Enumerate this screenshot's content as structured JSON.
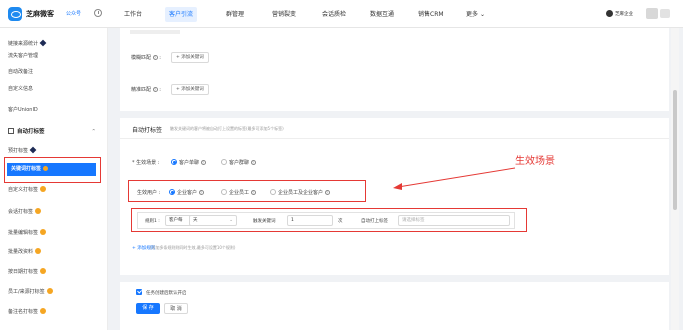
{
  "app": {
    "name": "芝麻微客",
    "account_tag": "公众号"
  },
  "nav": {
    "items": [
      "工作台",
      "客户引流",
      "群管理",
      "营销裂变",
      "会话质检",
      "数据互通",
      "销售CRM",
      "更多"
    ],
    "active_index": 1
  },
  "user": {
    "name": "芝麻企业"
  },
  "sidebar": {
    "items_above": [
      "链接来源统计",
      "流失客户管理",
      "自动改备注",
      "自定义信息",
      "客户UnionID"
    ],
    "group": {
      "label": "自动打标签"
    },
    "items_below": [
      {
        "label": "预打标签",
        "badge": "diamond"
      },
      {
        "label": "关键词打标签",
        "badge": "coin"
      },
      {
        "label": "自定义打标签",
        "badge": "coin"
      },
      {
        "label": "会话打标签",
        "badge": "coin"
      },
      {
        "label": "批量编辑标签",
        "badge": "coin"
      },
      {
        "label": "批量改资料",
        "badge": "coin"
      },
      {
        "label": "按日期打标签",
        "badge": "coin"
      },
      {
        "label": "员工/来源打标签",
        "badge": "coin"
      },
      {
        "label": "备注名打标签",
        "badge": "coin"
      }
    ],
    "active_label": "关键词打标签"
  },
  "keyword_card": {
    "fuzzy_label": "模糊匹配",
    "exact_label": "精准匹配",
    "add_keyword_label": "+ 添加关键词"
  },
  "tag_card": {
    "title": "自动打标签",
    "hint": "触发关键词的客户将被自动打上设置的标签(最多可添加5个标签)",
    "scene": {
      "label": "* 生效场景 :",
      "options": [
        "客户单聊",
        "客户群聊"
      ],
      "selected": 0
    },
    "target": {
      "label": "生效用户 :",
      "options": [
        "企业客户",
        "企业员工",
        "企业员工及企业客户"
      ],
      "selected": 0
    },
    "rule": {
      "label": "规则1 :",
      "subject": "客户每",
      "period": "天",
      "trigger_label": "触发关键词",
      "count": "1",
      "unit": "次",
      "tag_label": "自动打上标签",
      "tag_placeholder": "请选择标签"
    },
    "add_rule_label": "+ 添加规则",
    "add_rule_hint": "(添加多条规则则同时生效,最多可设置10个规则)"
  },
  "footer": {
    "checkbox_label": "任务创建后默认开启",
    "save_label": "保 存",
    "cancel_label": "取 消"
  },
  "annotation": {
    "text": "生效场景",
    "color": "#e53935"
  },
  "colors": {
    "accent": "#1677ff",
    "highlight": "#e53935"
  }
}
